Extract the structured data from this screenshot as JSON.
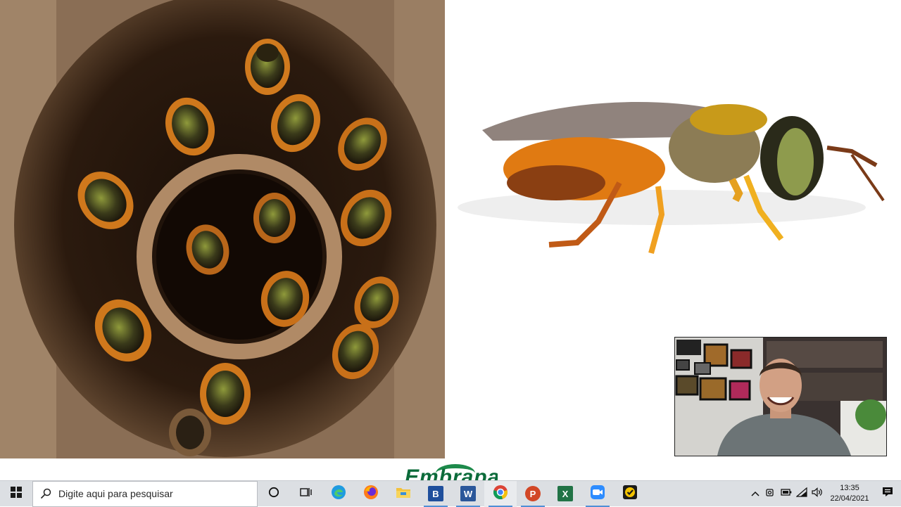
{
  "slide": {
    "logo_text": "Embrapa"
  },
  "taskbar": {
    "search_placeholder": "Digite aqui para pesquisar",
    "apps": [
      {
        "name": "cortana",
        "icon": "circle-icon"
      },
      {
        "name": "task-view",
        "icon": "task-view-icon"
      },
      {
        "name": "edge",
        "icon": "edge-icon"
      },
      {
        "name": "firefox",
        "icon": "firefox-icon"
      },
      {
        "name": "file-explorer",
        "icon": "folder-icon"
      },
      {
        "name": "b-app",
        "icon": "b-icon",
        "letter": "B",
        "color": "#1f4f9c"
      },
      {
        "name": "word",
        "icon": "word-icon",
        "letter": "W",
        "color": "#2b579a"
      },
      {
        "name": "chrome",
        "icon": "chrome-icon"
      },
      {
        "name": "powerpoint",
        "icon": "powerpoint-icon",
        "letter": "P",
        "color": "#d24726"
      },
      {
        "name": "excel",
        "icon": "excel-icon",
        "letter": "X",
        "color": "#217346"
      },
      {
        "name": "zoom",
        "icon": "zoom-icon",
        "color": "#2d8cff"
      },
      {
        "name": "norton",
        "icon": "check-shield-icon",
        "color": "#f2c200"
      }
    ],
    "clock": {
      "time": "13:35",
      "date": "22/04/2021"
    }
  },
  "colors": {
    "taskbar_bg": "#dcdfe3",
    "accent": "#4f8fd6",
    "logo_green": "#0b6b3a"
  }
}
